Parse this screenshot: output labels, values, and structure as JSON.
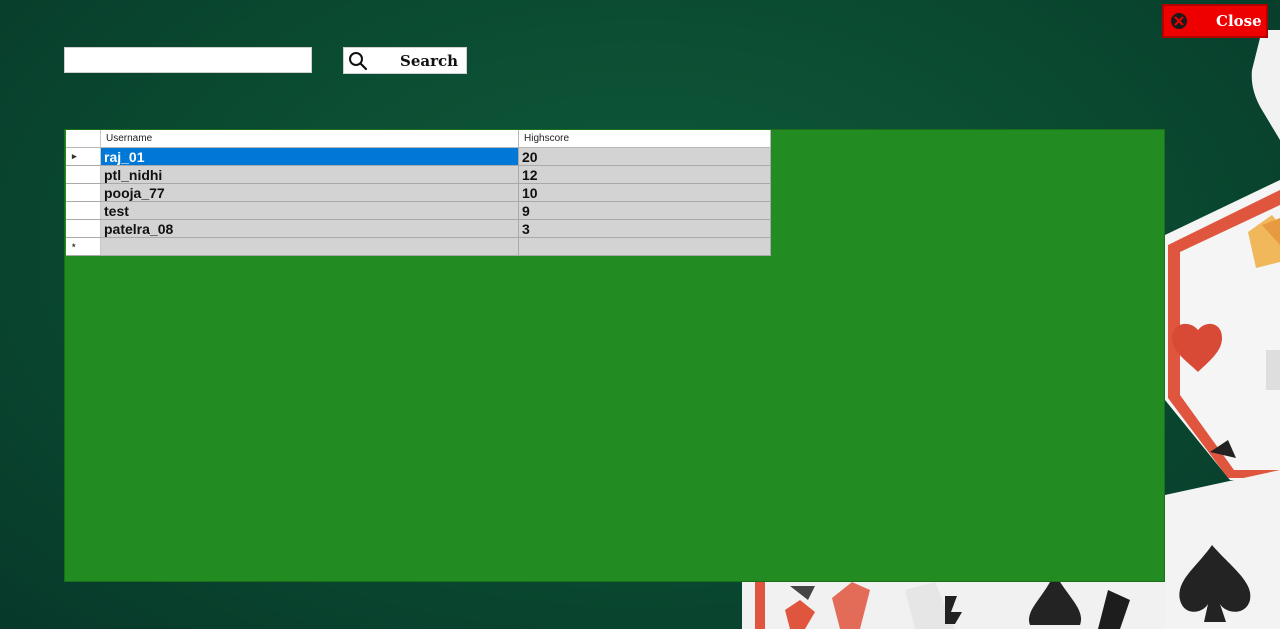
{
  "window": {
    "close_label": "Close"
  },
  "search": {
    "value": "",
    "placeholder": "",
    "button_label": "Search"
  },
  "grid": {
    "columns": [
      "Username",
      "Highscore"
    ],
    "rows": [
      {
        "username": "raj_01",
        "highscore": "20",
        "selected": true
      },
      {
        "username": "ptl_nidhi",
        "highscore": "12",
        "selected": false
      },
      {
        "username": "pooja_77",
        "highscore": "10",
        "selected": false
      },
      {
        "username": "test",
        "highscore": "9",
        "selected": false
      },
      {
        "username": "patelra_08",
        "highscore": "3",
        "selected": false
      }
    ],
    "current_row_glyph": "▸",
    "new_row_glyph": "*"
  },
  "colors": {
    "background": "#0a4a30",
    "grid_panel": "#228b22",
    "close_button": "#ee0000",
    "selection": "#0078d7",
    "cell": "#d3d3d3"
  },
  "icons": {
    "close": "close-circle-icon",
    "search": "magnifier-icon"
  }
}
